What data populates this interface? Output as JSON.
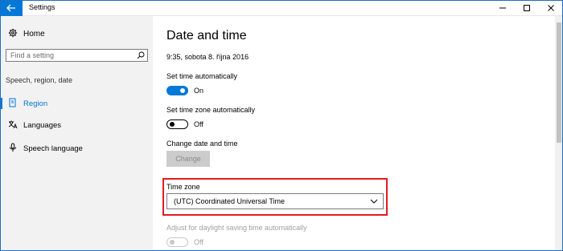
{
  "window": {
    "title": "Settings"
  },
  "sidebar": {
    "home_label": "Home",
    "search_placeholder": "Find a setting",
    "section_heading": "Speech, region, date",
    "items": [
      {
        "label": "Region",
        "active": true
      },
      {
        "label": "Languages",
        "active": false
      },
      {
        "label": "Speech language",
        "active": false
      }
    ]
  },
  "main": {
    "title": "Date and time",
    "current_datetime": "9:35, sobota 8. října 2016",
    "set_time_auto": {
      "label": "Set time automatically",
      "state": "On"
    },
    "set_timezone_auto": {
      "label": "Set time zone automatically",
      "state": "Off"
    },
    "change_datetime": {
      "label": "Change date and time",
      "button": "Change"
    },
    "timezone": {
      "label": "Time zone",
      "value": "(UTC) Coordinated Universal Time"
    },
    "daylight": {
      "label": "Adjust for daylight saving time automatically",
      "state": "Off"
    }
  },
  "colors": {
    "accent": "#0078d7",
    "highlight": "#e11b22",
    "sidebar_bg": "#f2f2f2"
  }
}
